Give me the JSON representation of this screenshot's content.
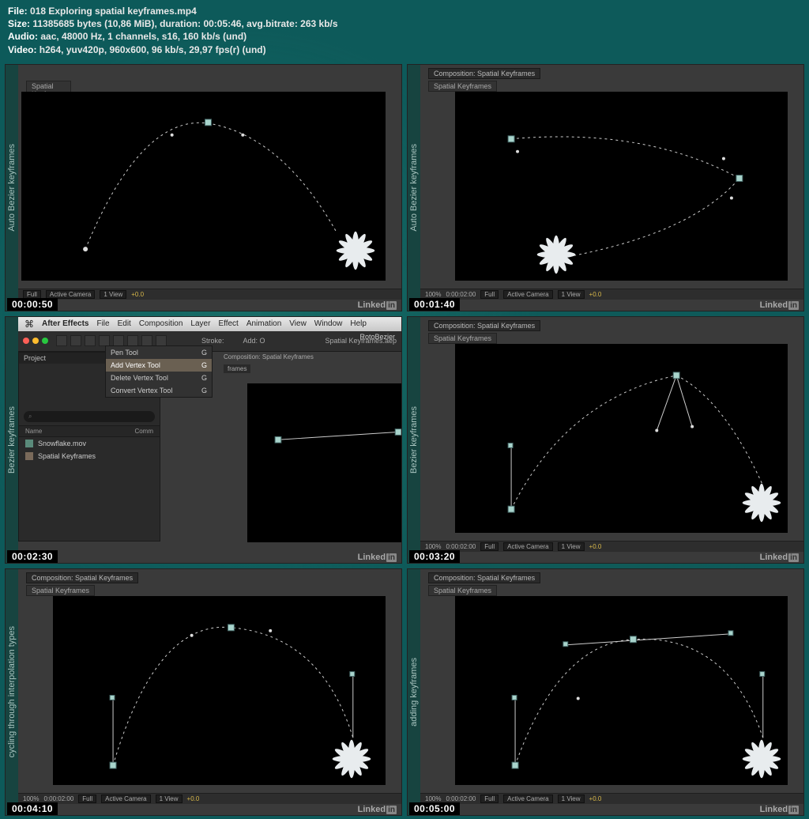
{
  "info": {
    "file_label": "File:",
    "file": "018 Exploring spatial keyframes.mp4",
    "size_label": "Size:",
    "size": "11385685 bytes (10,86 MiB), duration: 00:05:46, avg.bitrate: 263 kb/s",
    "audio_label": "Audio:",
    "audio": "aac, 48000 Hz, 1 channels, s16, 160 kb/s (und)",
    "video_label": "Video:",
    "video": "h264, yuv420p, 960x600, 96 kb/s, 29,97 fps(r) (und)"
  },
  "common": {
    "comp_prefix": "Composition:",
    "comp_name": "Spatial Keyframes",
    "tab_name": "Spatial Keyframes",
    "linkedin": "Linked",
    "linkedin_in": "in"
  },
  "status_bar": {
    "zoom": "100%",
    "timecode": "0:00:02:00",
    "res": "Full",
    "camera": "Active Camera",
    "view": "1 View",
    "offset": "+0.0"
  },
  "cells": [
    {
      "side": "Auto Bezier keyframes",
      "ts": "00:00:50"
    },
    {
      "side": "Auto Bezier keyframes",
      "ts": "00:01:40"
    },
    {
      "side": "Bezier keyframes",
      "ts": "00:02:30"
    },
    {
      "side": "Bezier keyframes",
      "ts": "00:03:20"
    },
    {
      "side": "cycling through interpolation types",
      "ts": "00:04:10"
    },
    {
      "side": "adding keyframes",
      "ts": "00:05:00"
    }
  ],
  "mac": {
    "app": "After Effects",
    "menu": [
      "File",
      "Edit",
      "Composition",
      "Layer",
      "Effect",
      "Animation",
      "View",
      "Window",
      "Help"
    ],
    "doc_title": "Spatial Keyframes.aep",
    "toolbar_right": "RotoBezier",
    "comp_tab": "Composition: Spatial Keyframes",
    "frames_tab": "frames",
    "stroke": "Stroke:",
    "add": "Add: O"
  },
  "pen_menu": [
    {
      "label": "Pen Tool",
      "key": "G",
      "hl": false
    },
    {
      "label": "Add Vertex Tool",
      "key": "G",
      "hl": true
    },
    {
      "label": "Delete Vertex Tool",
      "key": "G",
      "hl": false
    },
    {
      "label": "Convert Vertex Tool",
      "key": "G",
      "hl": false
    }
  ],
  "project": {
    "title": "Project",
    "cols": {
      "name": "Name",
      "comm": "Comm"
    },
    "items": [
      {
        "name": "Snowflake.mov",
        "type": "mov"
      },
      {
        "name": "Spatial Keyframes",
        "type": "comp"
      }
    ]
  }
}
